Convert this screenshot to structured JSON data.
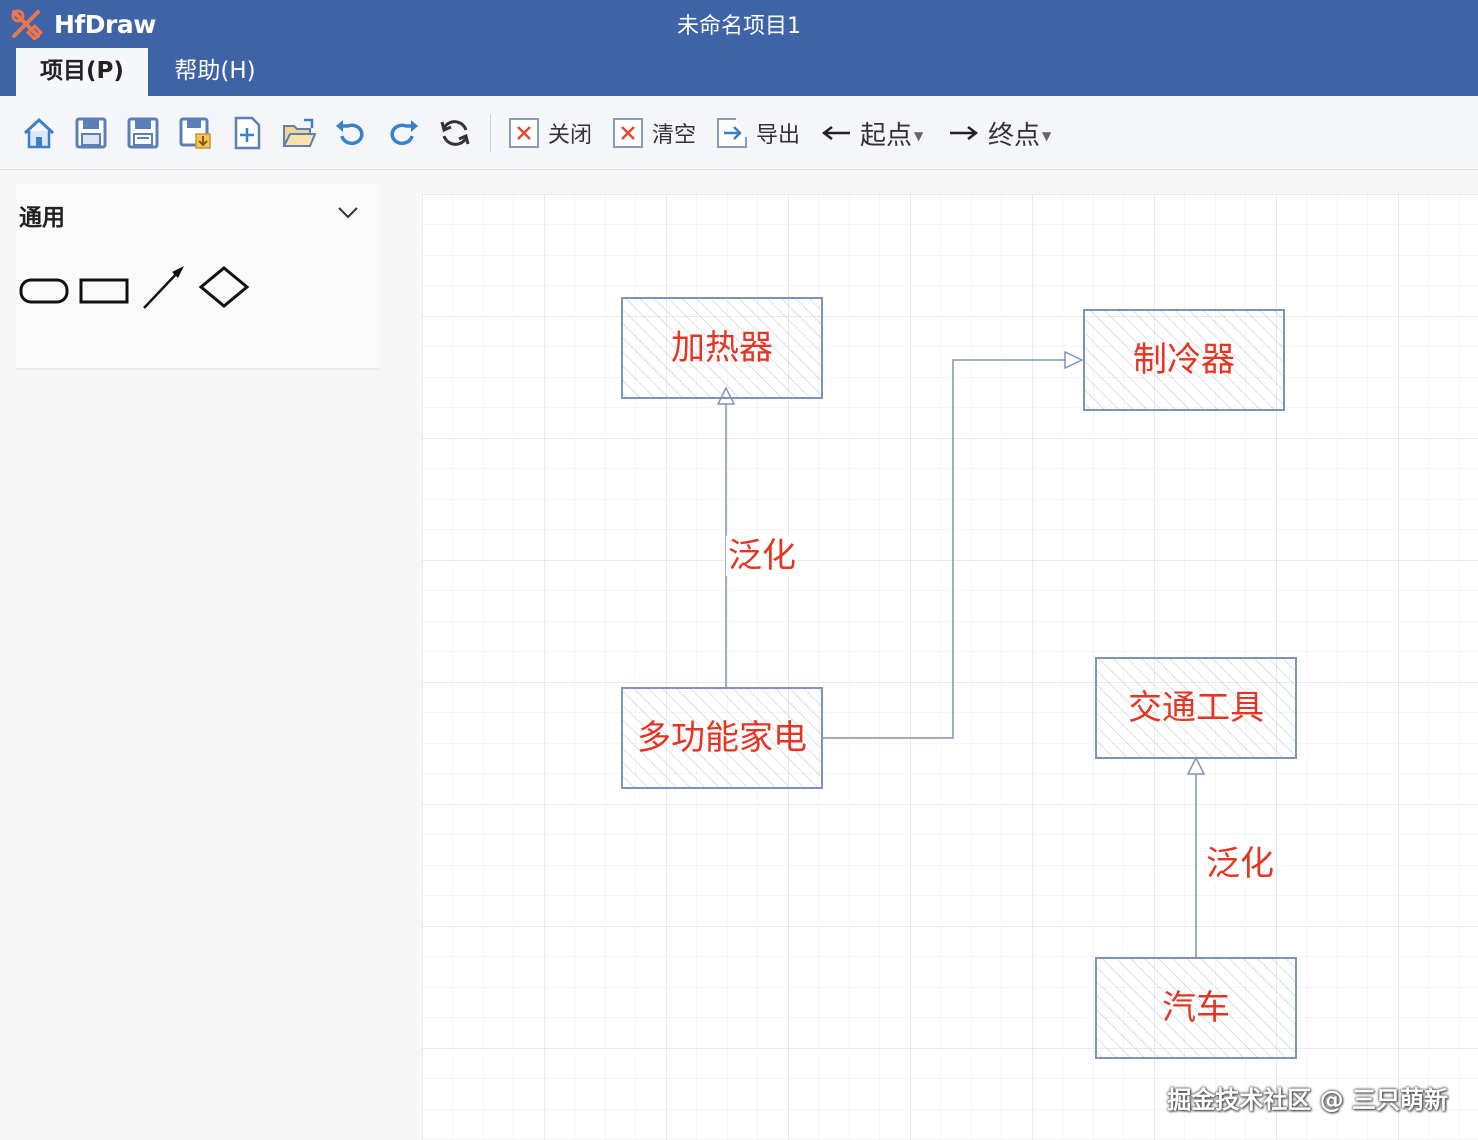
{
  "app": {
    "name": "HfDraw",
    "document_title": "未命名项目1"
  },
  "menu": {
    "tabs": [
      {
        "label": "项目(P)",
        "active": true
      },
      {
        "label": "帮助(H)",
        "active": false
      }
    ]
  },
  "toolbar": {
    "icons": [
      "home-icon",
      "save-icon",
      "save-as-icon",
      "save-export-icon",
      "new-file-icon",
      "open-folder-icon",
      "undo-icon",
      "redo-icon",
      "refresh-icon"
    ],
    "close_label": "关闭",
    "clear_label": "清空",
    "export_label": "导出",
    "start_label": "起点",
    "end_label": "终点"
  },
  "sidebar": {
    "panel_title": "通用",
    "shapes": [
      "rounded-rectangle",
      "rectangle",
      "arrow-line",
      "diamond"
    ]
  },
  "diagram": {
    "nodes": {
      "heater": "加热器",
      "cooler": "制冷器",
      "multi": "多功能家电",
      "transport": "交通工具",
      "car": "汽车"
    },
    "edges": {
      "gen1": "泛化",
      "gen2": "泛化"
    },
    "colors": {
      "node_border": "#7f93b8",
      "node_text": "#e53522",
      "edge": "#7f93b8",
      "grid": "#e6e6e6"
    }
  },
  "watermark": "掘金技术社区 @ 三只萌新"
}
